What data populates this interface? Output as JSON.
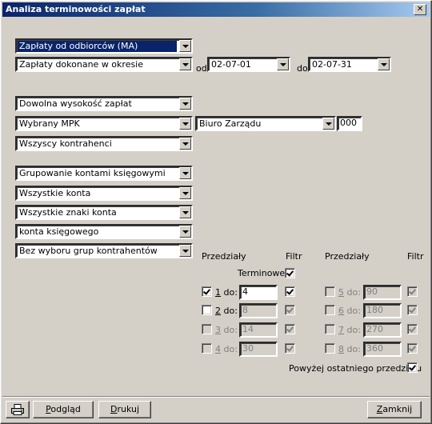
{
  "window": {
    "title": "Analiza terminowości zapłat",
    "close_glyph": "✕"
  },
  "filters": {
    "payment_type": "Zapłaty od odbiorców (MA)",
    "period_mode": "Zapłaty dokonane w okresie",
    "from_label": "od",
    "date_from": "02-07-01",
    "to_label": "do",
    "date_to": "02-07-31",
    "amount": "Dowolna wysokość zapłat",
    "mpk_mode": "Wybrany MPK",
    "mpk_name": "Biuro Zarządu",
    "mpk_code": "000",
    "contractors": "Wszyscy kontrahenci",
    "grouping": "Grupowanie kontami księgowymi",
    "accounts": "Wszystkie konta",
    "account_signs": "Wszystkie znaki konta",
    "account_type": "konta księgowego",
    "contractor_groups": "Bez wyboru grup kontrahentów"
  },
  "intervals": {
    "header_left": "Przedziały",
    "filter_left": "Filtr",
    "header_right": "Przedziały",
    "filter_right": "Filtr",
    "terminowe_label": "Terminowe",
    "terminowe_checked": true,
    "rows_left": [
      {
        "num": "1",
        "suffix": " do:",
        "value": "4",
        "enabled": true,
        "checked": true,
        "filter": true
      },
      {
        "num": "2",
        "suffix": " do:",
        "value": "8",
        "enabled": true,
        "checked": false,
        "filter": true
      },
      {
        "num": "3",
        "suffix": " do:",
        "value": "14",
        "enabled": false,
        "checked": false,
        "filter": true
      },
      {
        "num": "4",
        "suffix": " do:",
        "value": "30",
        "enabled": false,
        "checked": false,
        "filter": true
      }
    ],
    "rows_right": [
      {
        "num": "5",
        "suffix": " do:",
        "value": "90",
        "enabled": false,
        "checked": false,
        "filter": true
      },
      {
        "num": "6",
        "suffix": " do:",
        "value": "180",
        "enabled": false,
        "checked": false,
        "filter": true
      },
      {
        "num": "7",
        "suffix": " do:",
        "value": "270",
        "enabled": false,
        "checked": false,
        "filter": true
      },
      {
        "num": "8",
        "suffix": " do:",
        "value": "360",
        "enabled": false,
        "checked": false,
        "filter": true
      }
    ],
    "above_last_label": "Powyżej ostatniego przedziału",
    "above_last_checked": true
  },
  "buttons": {
    "preview_u": "P",
    "preview_rest": "odgląd",
    "print_u": "D",
    "print_rest": "rukuj",
    "close_u": "Z",
    "close_rest": "amknij"
  },
  "icons": {
    "printer": "printer-icon"
  }
}
